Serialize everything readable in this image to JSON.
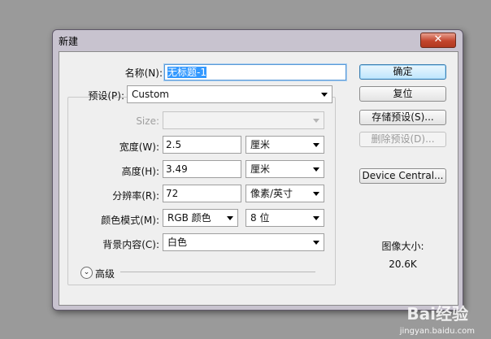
{
  "window": {
    "title": "新建",
    "close_glyph": "✕"
  },
  "form": {
    "name_label": "名称(N):",
    "name_value": "无标题-1",
    "preset_label": "预设(P):",
    "preset_value": "Custom",
    "size_label": "Size:",
    "size_value": "",
    "width_label": "宽度(W):",
    "width_value": "2.5",
    "width_unit": "厘米",
    "height_label": "高度(H):",
    "height_value": "3.49",
    "height_unit": "厘米",
    "resolution_label": "分辨率(R):",
    "resolution_value": "72",
    "resolution_unit": "像素/英寸",
    "color_mode_label": "颜色模式(M):",
    "color_mode_value": "RGB 颜色",
    "bit_depth_value": "8 位",
    "background_label": "背景内容(C):",
    "background_value": "白色",
    "advanced_label": "高级",
    "advanced_icon": "chevron-double-down-icon"
  },
  "buttons": {
    "ok": "确定",
    "reset": "复位",
    "save_preset": "存储预设(S)...",
    "delete_preset": "删除预设(D)...",
    "device_central": "Device Central..."
  },
  "image_size": {
    "label": "图像大小:",
    "value": "20.6K"
  },
  "watermark": {
    "brand": "Bai经验",
    "url": "jingyan.baidu.com"
  }
}
